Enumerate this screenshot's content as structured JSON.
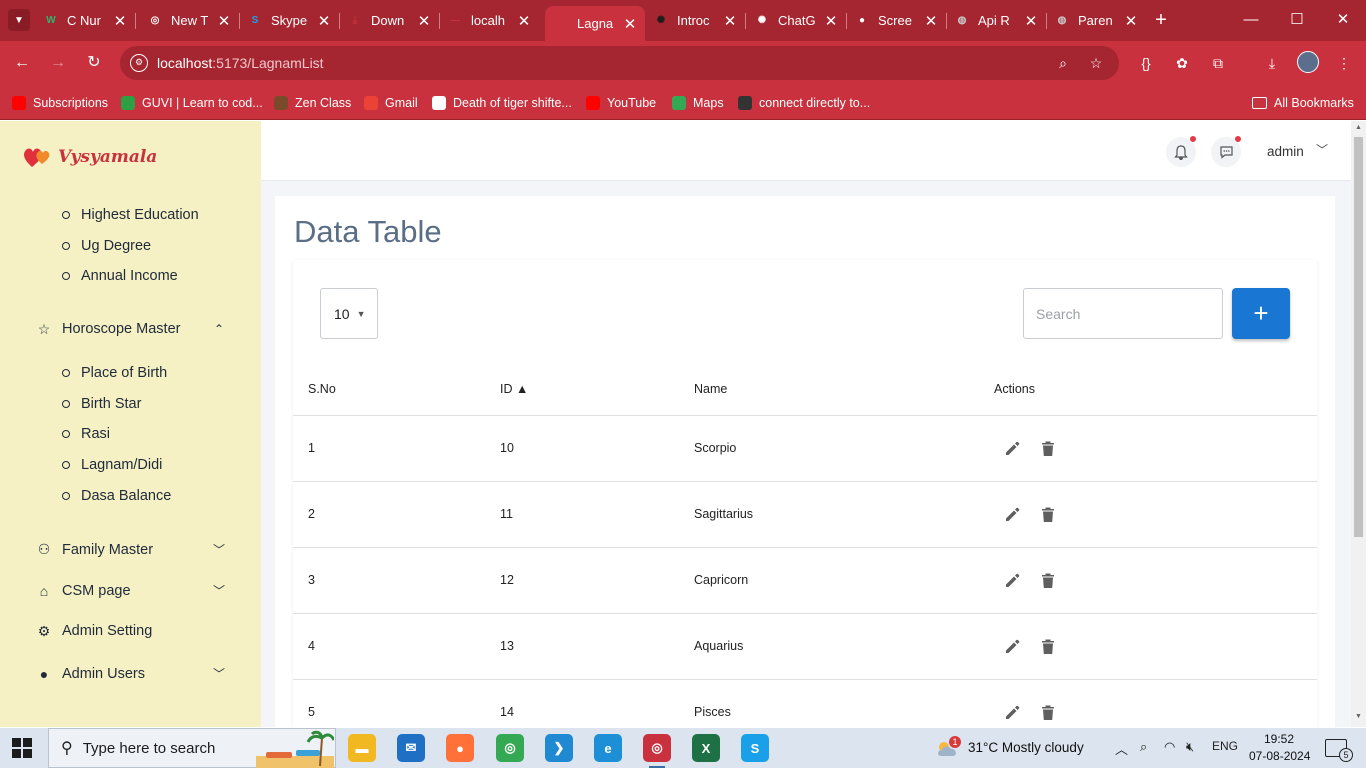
{
  "browser": {
    "tabs": [
      {
        "label": "C Nur",
        "favicon": "w-icon",
        "color": "#2bb673",
        "glyph": "W"
      },
      {
        "label": "New T",
        "favicon": "chrome-icon",
        "color": "#ffffff",
        "glyph": "◎"
      },
      {
        "label": "Skype",
        "favicon": "skype-icon",
        "color": "#1aa0e8",
        "glyph": "S"
      },
      {
        "label": "Down",
        "favicon": "download-icon",
        "color": "#c8313d",
        "glyph": "⤓"
      },
      {
        "label": "localh",
        "favicon": "localhost-icon",
        "color": "#c8313d",
        "glyph": "—"
      },
      {
        "label": "Lagna",
        "favicon": "vysyamala-icon",
        "color": "#c8313d",
        "glyph": "♥"
      },
      {
        "label": "Introc",
        "favicon": "openai-icon",
        "color": "#1d1d1d",
        "glyph": "✺"
      },
      {
        "label": "ChatG",
        "favicon": "chatgpt-icon",
        "color": "#ffffff",
        "glyph": "✺"
      },
      {
        "label": "Scree",
        "favicon": "camera-icon",
        "color": "#ffffff",
        "glyph": "●"
      },
      {
        "label": "Api R",
        "favicon": "globe-icon",
        "color": "#c8c8c8",
        "glyph": "◍"
      },
      {
        "label": "Paren",
        "favicon": "globe-icon",
        "color": "#c8c8c8",
        "glyph": "◍"
      }
    ],
    "active_tab": 5,
    "url_host": "localhost",
    "url_path": ":5173/LagnamList",
    "bookmarks": [
      {
        "label": "Subscriptions",
        "color": "#ff0000"
      },
      {
        "label": "GUVI | Learn to cod...",
        "color": "#2ea043"
      },
      {
        "label": "Zen Class",
        "color": "#7a4a2a"
      },
      {
        "label": "Gmail",
        "color": "#ea4335"
      },
      {
        "label": "Death of tiger shifte...",
        "color": "#ffffff"
      },
      {
        "label": "YouTube",
        "color": "#ff0000"
      },
      {
        "label": "Maps",
        "color": "#34a853"
      },
      {
        "label": "connect directly to...",
        "color": "#333333"
      }
    ],
    "all_bookmarks": "All Bookmarks"
  },
  "sidebar": {
    "logo": "Vysyamala",
    "education_items": [
      "Highest Education",
      "Ug Degree",
      "Annual Income"
    ],
    "horoscope_label": "Horoscope Master",
    "horoscope_items": [
      "Place of Birth",
      "Birth Star",
      "Rasi",
      "Lagnam/Didi",
      "Dasa Balance"
    ],
    "groups": [
      {
        "label": "Family Master",
        "icon": "family-icon",
        "chevron": true
      },
      {
        "label": "CSM page",
        "icon": "home-icon",
        "chevron": true
      },
      {
        "label": "Admin Setting",
        "icon": "gear-icon",
        "chevron": false
      },
      {
        "label": "Admin Users",
        "icon": "user-icon",
        "chevron": true
      }
    ]
  },
  "header": {
    "user": "admin"
  },
  "main": {
    "title": "Data Table",
    "page_size": "10",
    "search_placeholder": "Search",
    "add_label": "+",
    "columns": [
      "S.No",
      "ID ▲",
      "Name",
      "Actions"
    ],
    "rows": [
      {
        "sno": "1",
        "id": "10",
        "name": "Scorpio"
      },
      {
        "sno": "2",
        "id": "11",
        "name": "Sagittarius"
      },
      {
        "sno": "3",
        "id": "12",
        "name": "Capricorn"
      },
      {
        "sno": "4",
        "id": "13",
        "name": "Aquarius"
      },
      {
        "sno": "5",
        "id": "14",
        "name": "Pisces"
      }
    ]
  },
  "taskbar": {
    "search_placeholder": "Type here to search",
    "apps": [
      {
        "name": "file-explorer-icon",
        "color": "#f2b821",
        "glyph": "▬"
      },
      {
        "name": "mail-icon",
        "color": "#1f6fc5",
        "glyph": "✉"
      },
      {
        "name": "firefox-icon",
        "color": "#ff7139",
        "glyph": "●"
      },
      {
        "name": "chrome-icon",
        "color": "#34a853",
        "glyph": "◎"
      },
      {
        "name": "vscode-icon",
        "color": "#1f8ad2",
        "glyph": "❯"
      },
      {
        "name": "edge-icon",
        "color": "#1d8fd6",
        "glyph": "e"
      },
      {
        "name": "chrome-profile-icon",
        "color": "#c8313d",
        "glyph": "◎"
      },
      {
        "name": "excel-icon",
        "color": "#1e7145",
        "glyph": "X"
      },
      {
        "name": "skype-icon",
        "color": "#1aa0e8",
        "glyph": "S"
      }
    ],
    "weather_badge": "1",
    "weather": "31°C  Mostly cloudy",
    "language": "ENG",
    "time": "19:52",
    "date": "07-08-2024",
    "notifications": "5"
  }
}
